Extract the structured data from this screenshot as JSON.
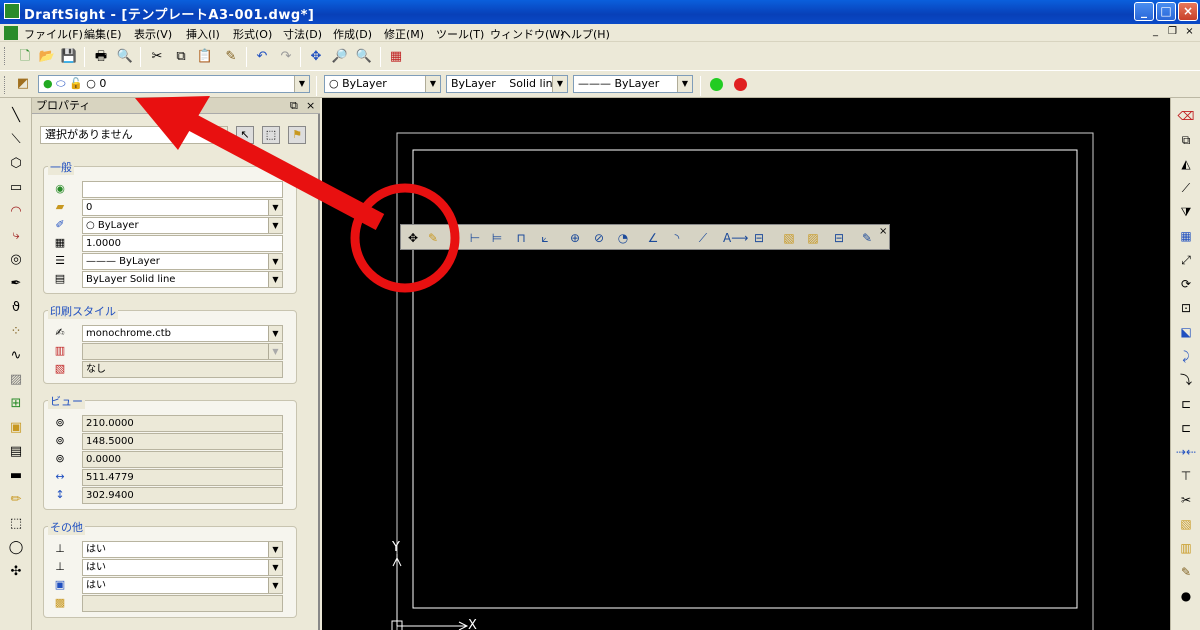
{
  "window": {
    "title": "DraftSight - [テンプレートA3-001.dwg*]",
    "min_label": "_",
    "max_label": "□",
    "close_label": "×"
  },
  "menu": {
    "items": [
      "ファイル(F)",
      "編集(E)",
      "表示(V)",
      "挿入(I)",
      "形式(O)",
      "寸法(D)",
      "作成(D)",
      "修正(M)",
      "ツール(T)",
      "ウィンドウ(W)",
      "ヘルプ(H)"
    ],
    "mdi_min": "_",
    "mdi_restore": "❐",
    "mdi_close": "×"
  },
  "toolbar_layer": {
    "layer_value": "0",
    "color_value": "ByLayer",
    "linetype_value": "ByLayer",
    "linestyle_value": "Solid line",
    "lineweight_value": "——— ByLayer",
    "green_dot_color": "#22cc22",
    "red_dot_color": "#e02020"
  },
  "properties_panel": {
    "title": "プロパティ",
    "selection_value": "選択がありません",
    "groups": {
      "general": {
        "title": "一般",
        "rows": [
          "",
          "0",
          "ByLayer",
          "1.0000",
          "——— ByLayer",
          "ByLayer      Solid line"
        ]
      },
      "print_style": {
        "title": "印刷スタイル",
        "rows": [
          "monochrome.ctb",
          "",
          "なし"
        ]
      },
      "view": {
        "title": "ビュー",
        "rows": [
          "210.0000",
          "148.5000",
          "0.0000",
          "511.4779",
          "302.9400"
        ]
      },
      "other": {
        "title": "その他",
        "rows": [
          "はい",
          "はい",
          "はい",
          ""
        ]
      }
    }
  },
  "canvas": {
    "axis_y_label": "Y",
    "axis_x_label": "X",
    "float_toolbar_close": "×"
  },
  "annotation_color": "#e81010"
}
